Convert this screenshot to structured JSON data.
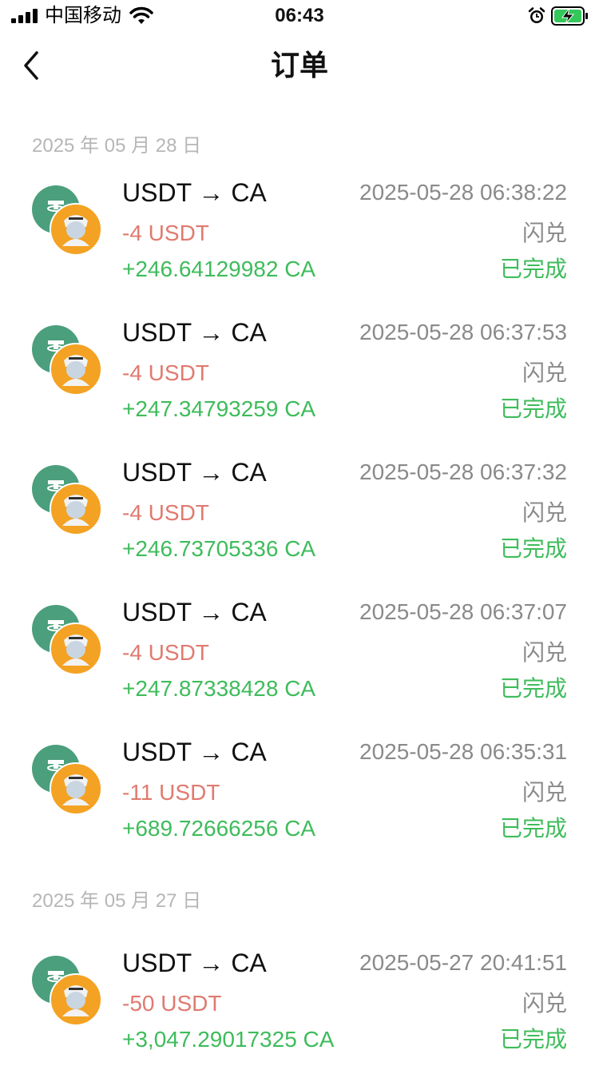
{
  "status_bar": {
    "carrier": "中国移动",
    "time": "06:43"
  },
  "header": {
    "title": "订单"
  },
  "groups": [
    {
      "date": "2025 年 05 月 28 日",
      "orders": [
        {
          "pair": "USDT → CA",
          "time": "2025-05-28 06:38:22",
          "from_amount": "-4 USDT",
          "type": "闪兑",
          "to_amount": "+246.64129982 CA",
          "status": "已完成"
        },
        {
          "pair": "USDT → CA",
          "time": "2025-05-28 06:37:53",
          "from_amount": "-4 USDT",
          "type": "闪兑",
          "to_amount": "+247.34793259 CA",
          "status": "已完成"
        },
        {
          "pair": "USDT → CA",
          "time": "2025-05-28 06:37:32",
          "from_amount": "-4 USDT",
          "type": "闪兑",
          "to_amount": "+246.73705336 CA",
          "status": "已完成"
        },
        {
          "pair": "USDT → CA",
          "time": "2025-05-28 06:37:07",
          "from_amount": "-4 USDT",
          "type": "闪兑",
          "to_amount": "+247.87338428 CA",
          "status": "已完成"
        },
        {
          "pair": "USDT → CA",
          "time": "2025-05-28 06:35:31",
          "from_amount": "-11 USDT",
          "type": "闪兑",
          "to_amount": "+689.72666256 CA",
          "status": "已完成"
        }
      ]
    },
    {
      "date": "2025 年 05 月 27 日",
      "orders": [
        {
          "pair": "USDT → CA",
          "time": "2025-05-27 20:41:51",
          "from_amount": "-50 USDT",
          "type": "闪兑",
          "to_amount": "+3,047.29017325 CA",
          "status": "已完成"
        }
      ]
    }
  ],
  "colors": {
    "debit": "#e07a6f",
    "credit": "#3ebc5b",
    "usdt_coin": "#4b9f7c",
    "ca_coin": "#f4a223",
    "muted": "#8a8a8a"
  },
  "icons": {
    "back": "chevron-left-icon",
    "usdt": "usdt-coin-icon",
    "ca": "ca-coin-icon"
  }
}
